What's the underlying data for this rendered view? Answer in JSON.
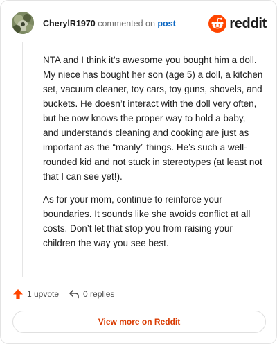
{
  "header": {
    "username": "CherylR1970",
    "action_text": "commented on",
    "post_link": "post",
    "brand_wordmark": "reddit"
  },
  "comment": {
    "paragraphs": [
      "NTA and I think it’s awesome you bought him a doll. My niece has bought her son (age 5) a doll, a kitchen set, vacuum cleaner, toy cars, toy guns, shovels, and buckets. He doesn’t interact with the doll very often, but he now knows the proper way to hold a baby, and understands cleaning and cooking are just as important as the “manly” things. He’s such a well-rounded kid and not stuck in stereotypes (at least not that I can see yet!).",
      "As for your mom, continue to reinforce your boundaries. It sounds like she avoids conflict at all costs. Don’t let that stop you from raising your children the way you see best."
    ]
  },
  "actions": {
    "upvote_label": "1 upvote",
    "replies_label": "0 replies",
    "upvote_icon": "upvote-arrow-icon",
    "reply_icon": "reply-arrow-icon"
  },
  "footer": {
    "view_more_label": "View more on Reddit"
  },
  "colors": {
    "brand": "#ff4500",
    "link": "#0a66c2",
    "view_more": "#d93a00"
  }
}
